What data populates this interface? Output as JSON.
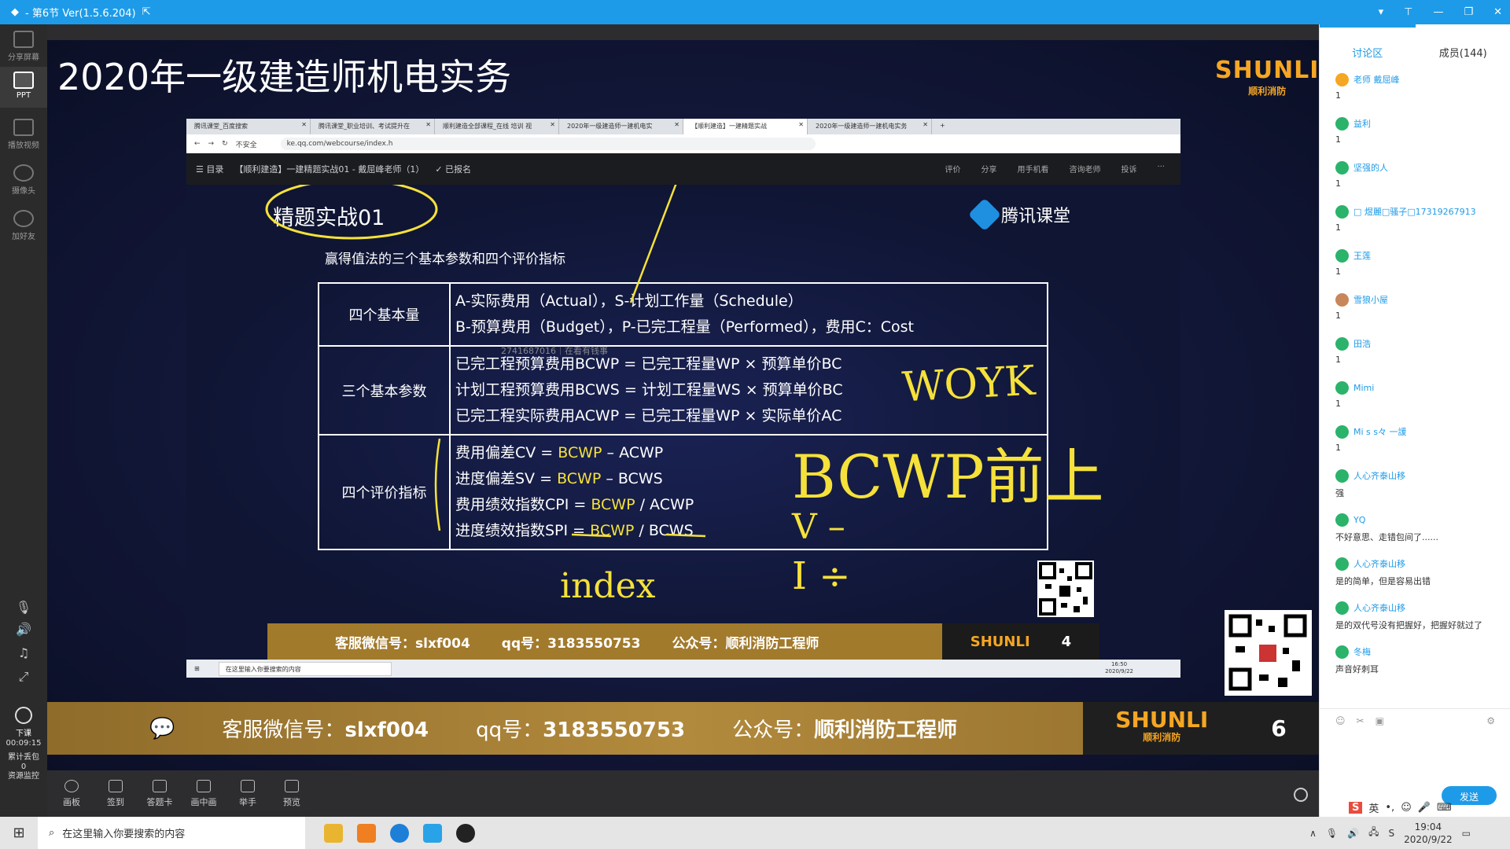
{
  "window": {
    "title": "- 第6节 Ver(1.5.6.204)",
    "controls": [
      "▾",
      "⊤",
      "—",
      "❐",
      "✕"
    ]
  },
  "left_sidebar": {
    "items": [
      {
        "label": "分享屏幕",
        "icon": "share-screen-icon"
      },
      {
        "label": "PPT",
        "icon": "ppt-icon"
      },
      {
        "label": "播放视频",
        "icon": "play-video-icon"
      },
      {
        "label": "摄像头",
        "icon": "camera-icon"
      },
      {
        "label": "加好友",
        "icon": "add-friend-icon"
      }
    ],
    "end_class_label": "下课",
    "timer": "00:09:15",
    "stats_label": "累计丢包",
    "stats_value": "0",
    "resource_label": "资源监控"
  },
  "slide": {
    "main_title": "2020年一级建造师机电实务",
    "logo_text": "SHUNLI",
    "logo_sub": "顺利消防"
  },
  "browser": {
    "tabs": [
      "腾讯课堂_百度搜索",
      "腾讯课堂_职业培训、考试提升在",
      "顺利建造全部课程_在线 培训 视",
      "2020年一级建造师一建机电实",
      "【顺利建造】一建精题实战",
      "2020年一级建造师一建机电实务"
    ],
    "address": "ke.qq.com/webcourse/index.h",
    "insecure_label": "不安全",
    "course_bar": {
      "menu": "☰ 目录",
      "title": "【顺利建造】一建精题实战01 - 戴屈峰老师（1）",
      "enrolled": "✓ 已报名",
      "right_items": [
        "评价",
        "分享",
        "用手机看",
        "咨询老师",
        "投诉",
        "···"
      ]
    }
  },
  "lecture": {
    "handwritten_title": "精题实战01",
    "tencent_logo": "腾讯课堂",
    "subtitle": "赢得值法的三个基本参数和四个评价指标",
    "rows": [
      {
        "head": "四个基本量",
        "lines": [
          "A-实际费用（Actual），S-计划工作量（Schedule）",
          "B-预算费用（Budget），P-已完工程量（Performed），费用C：Cost"
        ]
      },
      {
        "head": "三个基本参数",
        "lines": [
          "已完工程预算费用BCWP = 已完工程量WP × 预算单价BC",
          "计划工程预算费用BCWS = 计划工程量WS × 预算单价BC",
          "已完工程实际费用ACWP = 已完工程量WP × 实际单价AC"
        ]
      },
      {
        "head": "四个评价指标",
        "lines": [
          [
            "费用偏差CV = ",
            "BCWP",
            " – ACWP"
          ],
          [
            "进度偏差SV = ",
            "BCWP",
            " – BCWS"
          ],
          [
            "费用绩效指数CPI = ",
            "BCWP",
            " / ACWP"
          ],
          [
            "进度绩效指数SPI = ",
            "BCWP",
            " / BCWS"
          ]
        ]
      }
    ],
    "watermark": "2741687016｜在看有钱事",
    "annotations": [
      "WOYK",
      "BCWP前上",
      "V –",
      "I ÷",
      "index"
    ],
    "banner": {
      "wechat_label": "客服微信号：",
      "wechat": "slxf004",
      "qq_label": "qq号：",
      "qq": "3183550753",
      "gzh_label": "公众号：",
      "gzh": "顺利消防工程师",
      "page": "4"
    },
    "inner_taskbar": {
      "search": "在这里输入你要搜索的内容",
      "time": "16:50",
      "date": "2020/9/22"
    }
  },
  "bottom_banner": {
    "wechat_label": "客服微信号：",
    "wechat": "slxf004",
    "qq_label": "qq号：",
    "qq": "3183550753",
    "gzh_label": "公众号：",
    "gzh": "顺利消防工程师",
    "logo_text": "SHUNLI",
    "logo_sub": "顺利消防",
    "page": "6"
  },
  "toolbar": {
    "items": [
      "画板",
      "签到",
      "答题卡",
      "画中画",
      "举手",
      "预览"
    ]
  },
  "chat": {
    "tab_discuss": "讨论区",
    "tab_members": "成员(144)",
    "messages": [
      {
        "name": "老师 戴屈峰",
        "text": "1"
      },
      {
        "name": "益利",
        "text": "1"
      },
      {
        "name": "坚强的人",
        "text": "1"
      },
      {
        "name": "□ 煜麗□骚子□17319267913",
        "text": "1"
      },
      {
        "name": "王莲",
        "text": "1"
      },
      {
        "name": "雪狼小屋",
        "text": "1"
      },
      {
        "name": "田浩",
        "text": "1"
      },
      {
        "name": "Mimi",
        "text": "1"
      },
      {
        "name": "Mi s s々 一諼",
        "text": "1"
      },
      {
        "name": "人心齐泰山移",
        "text": "强"
      },
      {
        "name": "YQ",
        "text": "不好意思、走错包间了......"
      },
      {
        "name": "人心齐泰山移",
        "text": "是的简单，但是容易出错"
      },
      {
        "name": "人心齐泰山移",
        "text": "是的双代号没有把握好，把握好就过了"
      },
      {
        "name": "冬梅",
        "text": "声音好刺耳"
      }
    ],
    "send_label": "发送",
    "ime_label": "英"
  },
  "taskbar": {
    "search_placeholder": "在这里输入你要搜索的内容",
    "time": "19:04",
    "date": "2020/9/22"
  },
  "colors": {
    "titlebar": "#1e9be8",
    "accent": "#1e9be8",
    "highlight": "#f5e13a",
    "gold": "#a27a2c"
  }
}
